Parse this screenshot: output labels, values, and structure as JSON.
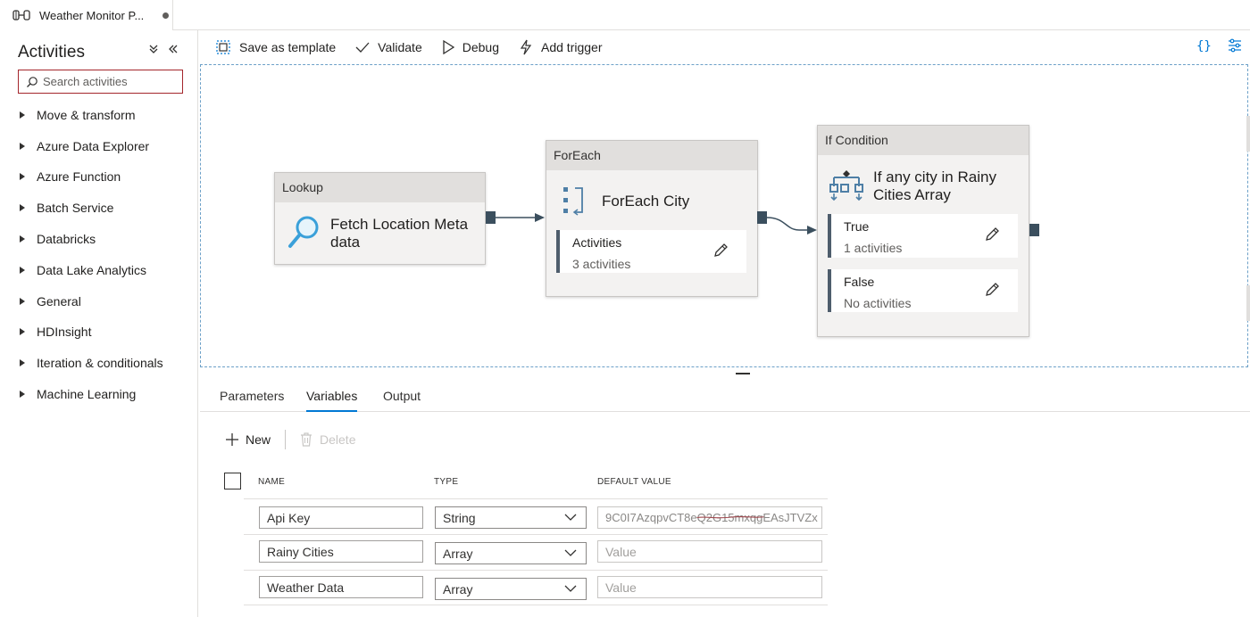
{
  "tab": {
    "title": "Weather Monitor P..."
  },
  "sidebar": {
    "title": "Activities",
    "search_placeholder": "Search activities",
    "categories": [
      "Move & transform",
      "Azure Data Explorer",
      "Azure Function",
      "Batch Service",
      "Databricks",
      "Data Lake Analytics",
      "General",
      "HDInsight",
      "Iteration & conditionals",
      "Machine Learning"
    ]
  },
  "toolbar": {
    "save_template": "Save as template",
    "validate": "Validate",
    "debug": "Debug",
    "add_trigger": "Add trigger"
  },
  "canvas": {
    "lookup": {
      "type": "Lookup",
      "name": "Fetch Location Meta data"
    },
    "foreach": {
      "type": "ForEach",
      "name": "ForEach City",
      "inner_title": "Activities",
      "inner_count": "3 activities"
    },
    "ifcond": {
      "type": "If Condition",
      "name": "If any city in Rainy Cities Array",
      "true_label": "True",
      "true_count": "1 activities",
      "false_label": "False",
      "false_count": "No activities"
    }
  },
  "panel": {
    "tabs": [
      "Parameters",
      "Variables",
      "Output"
    ],
    "active_tab": "Variables",
    "new_label": "New",
    "delete_label": "Delete",
    "columns": [
      "NAME",
      "TYPE",
      "DEFAULT VALUE"
    ],
    "rows": [
      {
        "name": "Api Key",
        "type": "String",
        "value": "9C0I7AzqpvCT8eQ2G15mxqgEAsJTVZx"
      },
      {
        "name": "Rainy Cities",
        "type": "Array",
        "value": ""
      },
      {
        "name": "Weather Data",
        "type": "Array",
        "value": ""
      }
    ],
    "value_placeholder": "Value"
  },
  "colors": {
    "accent": "#0078d4",
    "node_header": "#e1dfdd",
    "port": "#3b4f5e"
  }
}
